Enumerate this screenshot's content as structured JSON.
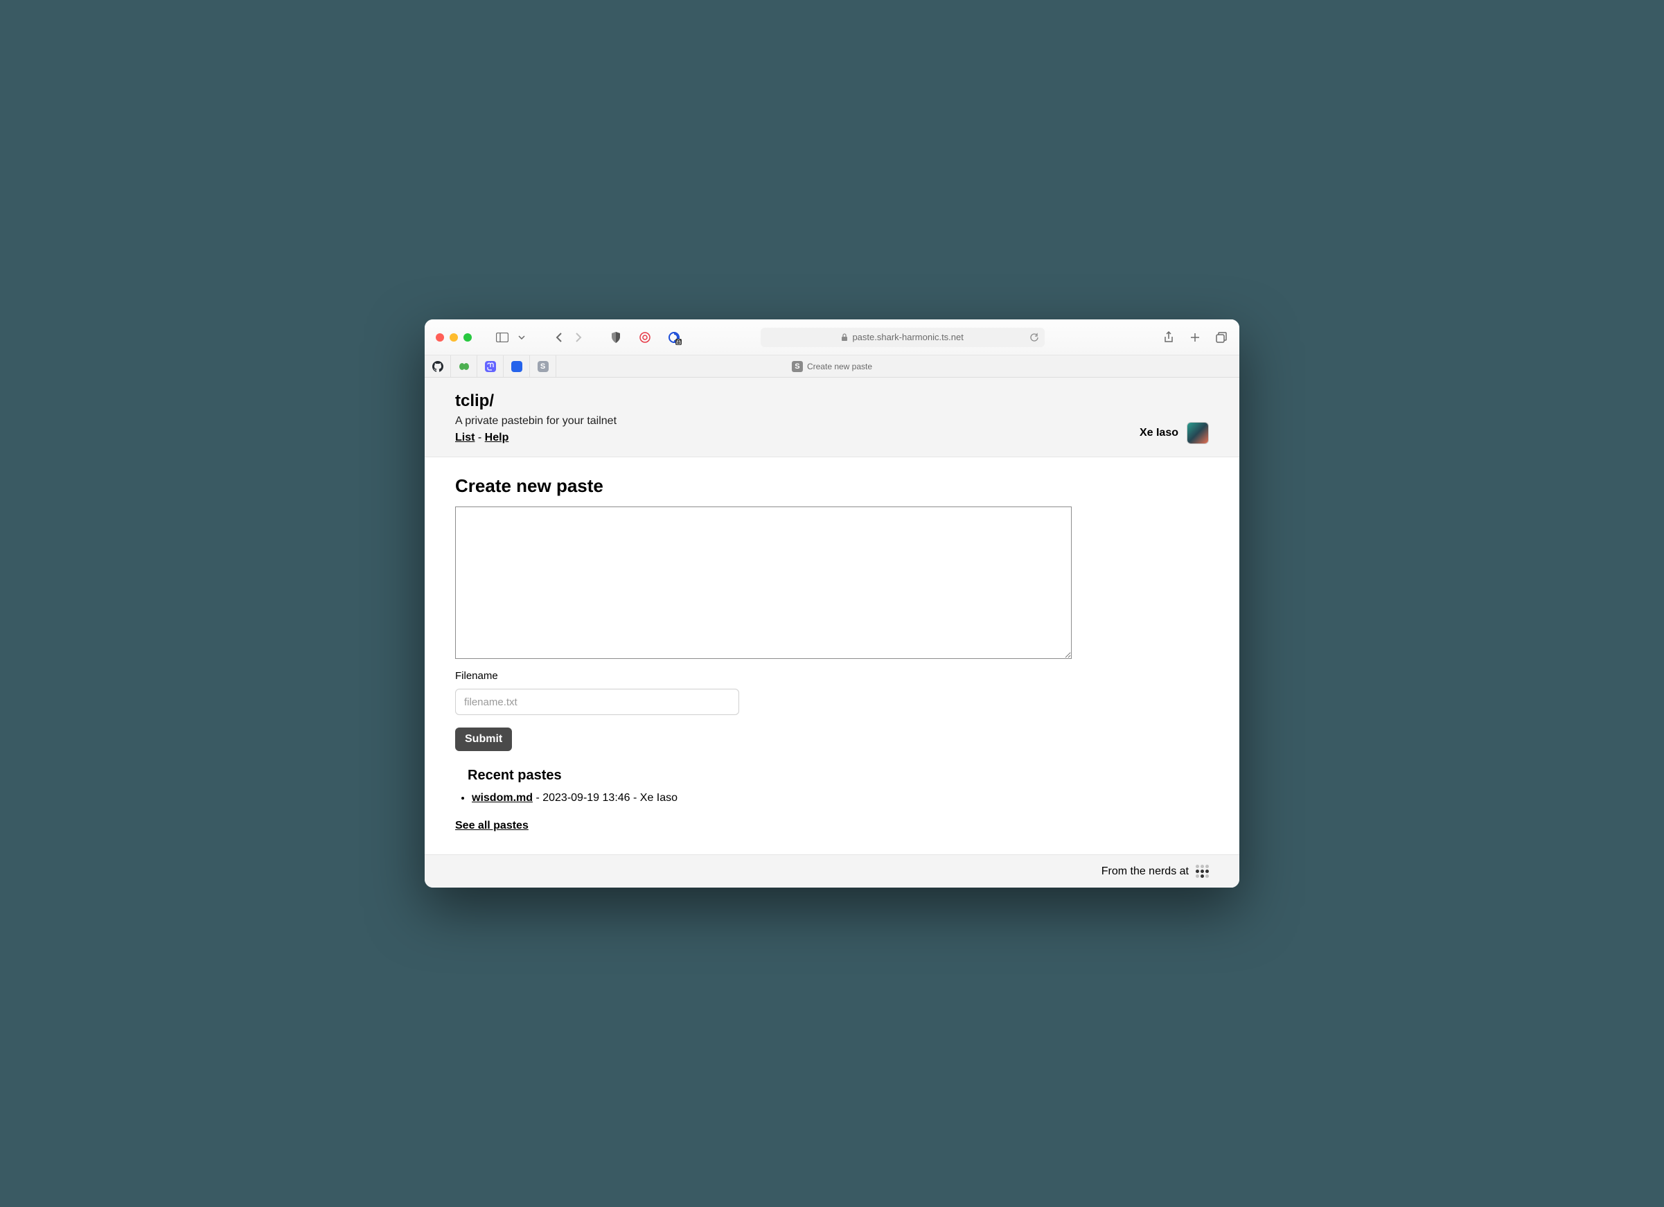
{
  "browser": {
    "url": "paste.shark-harmonic.ts.net",
    "tab_title": "Create new paste"
  },
  "header": {
    "title": "tclip/",
    "tagline": "A private pastebin for your tailnet",
    "nav": {
      "list": "List",
      "sep": " - ",
      "help": "Help"
    },
    "user": "Xe Iaso"
  },
  "form": {
    "heading": "Create new paste",
    "filename_label": "Filename",
    "filename_placeholder": "filename.txt",
    "submit_label": "Submit"
  },
  "recent": {
    "heading": "Recent pastes",
    "items": [
      {
        "name": "wisdom.md",
        "meta": " - 2023-09-19 13:46 - Xe Iaso"
      }
    ],
    "see_all": "See all pastes"
  },
  "footer": {
    "text": "From the nerds at"
  }
}
